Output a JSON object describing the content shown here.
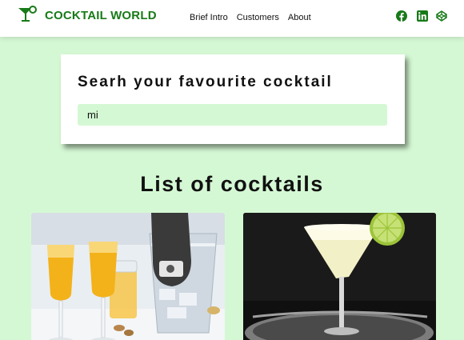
{
  "navbar": {
    "brand": "COCKTAIL WORLD",
    "brand_icon": "cocktail-glass-icon",
    "links": [
      "Brief Intro",
      "Customers",
      "About"
    ],
    "social_icons": [
      "facebook-icon",
      "linkedin-icon",
      "codepen-icon"
    ],
    "accent": "#187a18"
  },
  "search": {
    "title": "Searh your favourite cocktail",
    "value": "mi"
  },
  "list": {
    "title": "List of cocktails"
  },
  "colors": {
    "background": "#d5f8d4",
    "input_background": "#d5f8d4",
    "brand": "#187a18"
  }
}
